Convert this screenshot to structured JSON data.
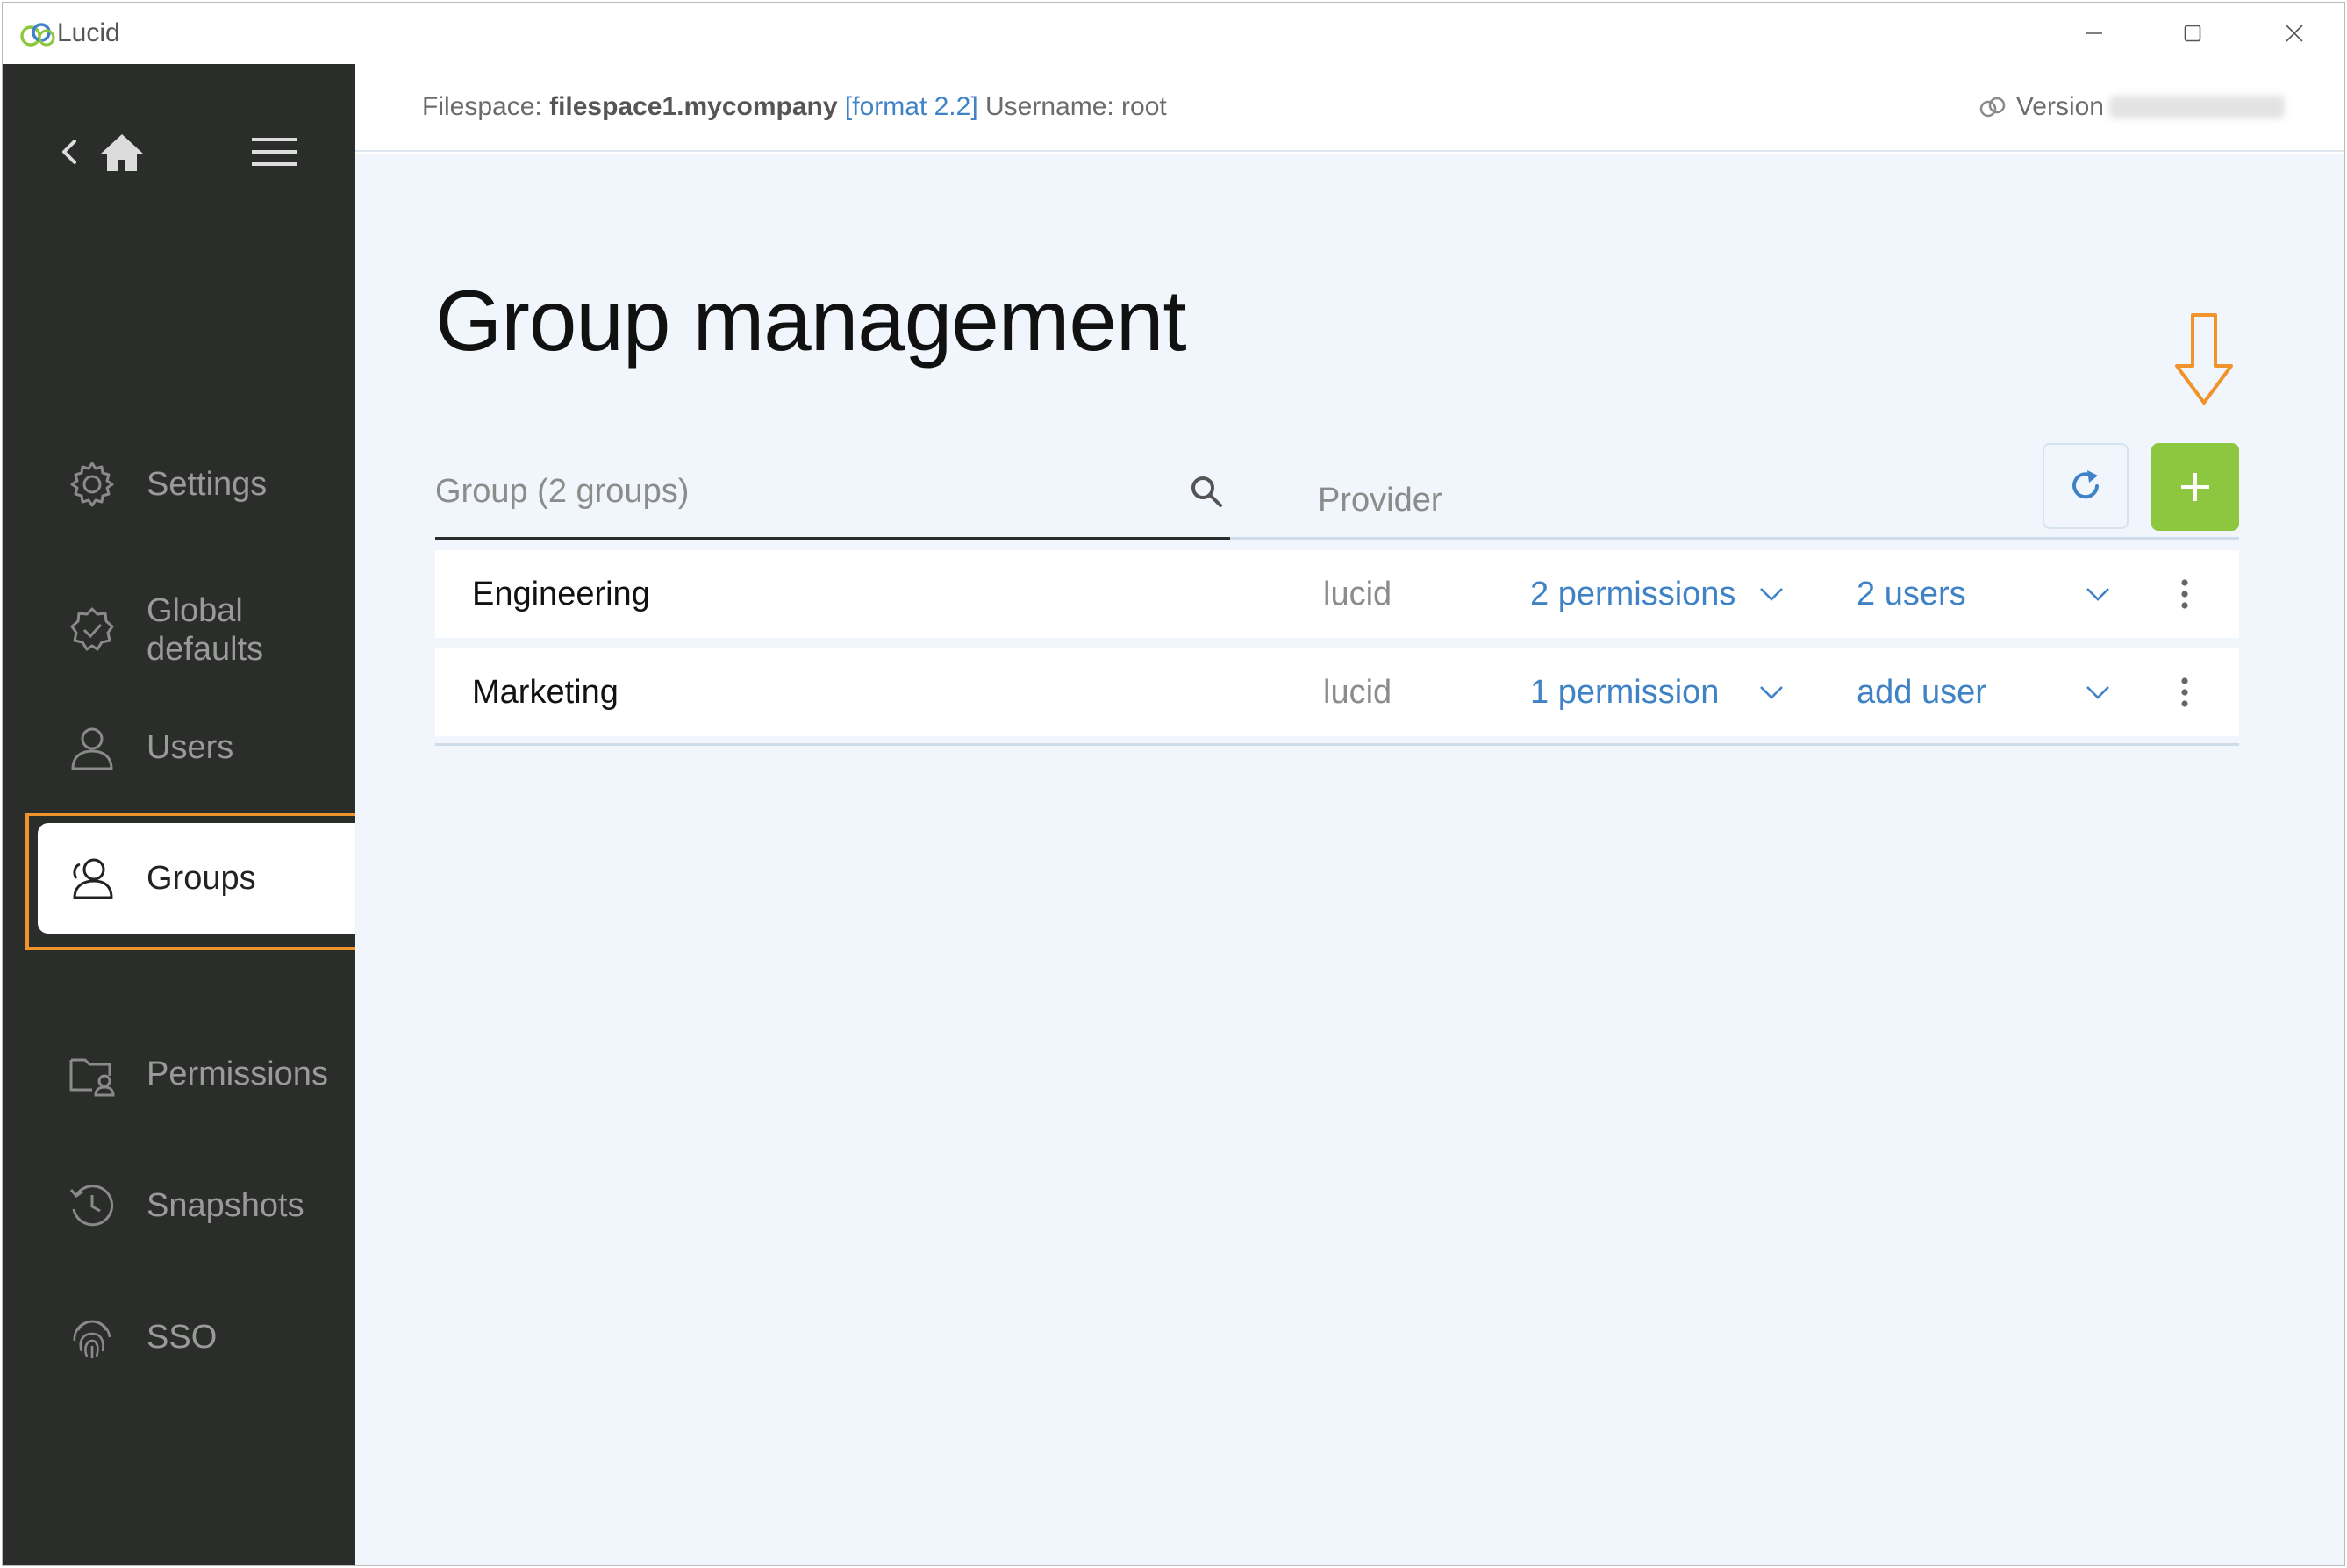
{
  "window": {
    "app_title": "Lucid",
    "controls": {
      "minimize": "—",
      "maximize": "☐",
      "close": "✕"
    }
  },
  "sidebar": {
    "items": [
      {
        "label": "Settings",
        "icon": "gear-icon",
        "active": false
      },
      {
        "label": "Global defaults",
        "icon": "badge-check-icon",
        "active": false
      },
      {
        "label": "Users",
        "icon": "user-icon",
        "active": false
      },
      {
        "label": "Groups",
        "icon": "group-icon",
        "active": true
      },
      {
        "label": "Permissions",
        "icon": "folder-user-icon",
        "active": false
      },
      {
        "label": "Snapshots",
        "icon": "history-icon",
        "active": false
      },
      {
        "label": "SSO",
        "icon": "fingerprint-icon",
        "active": false
      }
    ]
  },
  "header": {
    "filespace_label": "Filespace:",
    "filespace_name": "filespace1.mycompany",
    "format": "[format 2.2]",
    "username": "Username: root",
    "version_label": "Version"
  },
  "main": {
    "title": "Group management",
    "search": {
      "placeholder": "Group (2 groups)"
    },
    "provider_header": "Provider",
    "groups": [
      {
        "name": "Engineering",
        "provider": "lucid",
        "permissions": "2 permissions",
        "users": "2 users"
      },
      {
        "name": "Marketing",
        "provider": "lucid",
        "permissions": "1 permission",
        "users": "add user"
      }
    ]
  },
  "colors": {
    "sidebar_bg": "#2b2d2b",
    "accent_blue": "#3f82c6",
    "add_green": "#8dc63f",
    "highlight_orange": "#f0932b",
    "main_bg": "#f1f6fc"
  }
}
